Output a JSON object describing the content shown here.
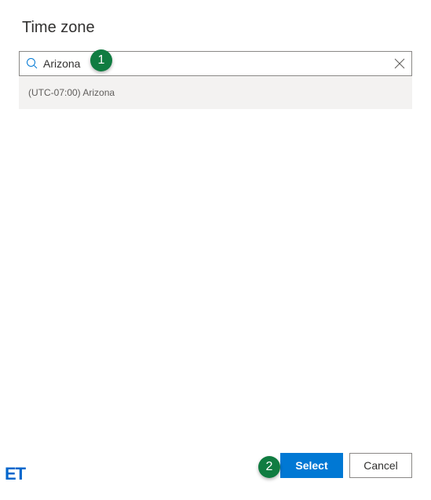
{
  "header": {
    "title": "Time zone"
  },
  "search": {
    "value": "Arizona",
    "placeholder": ""
  },
  "results": {
    "items": [
      {
        "label": "(UTC-07:00) Arizona"
      }
    ]
  },
  "footer": {
    "select_label": "Select",
    "cancel_label": "Cancel"
  },
  "annotations": {
    "badge1": "1",
    "badge2": "2"
  },
  "watermark": {
    "text": "ET"
  }
}
